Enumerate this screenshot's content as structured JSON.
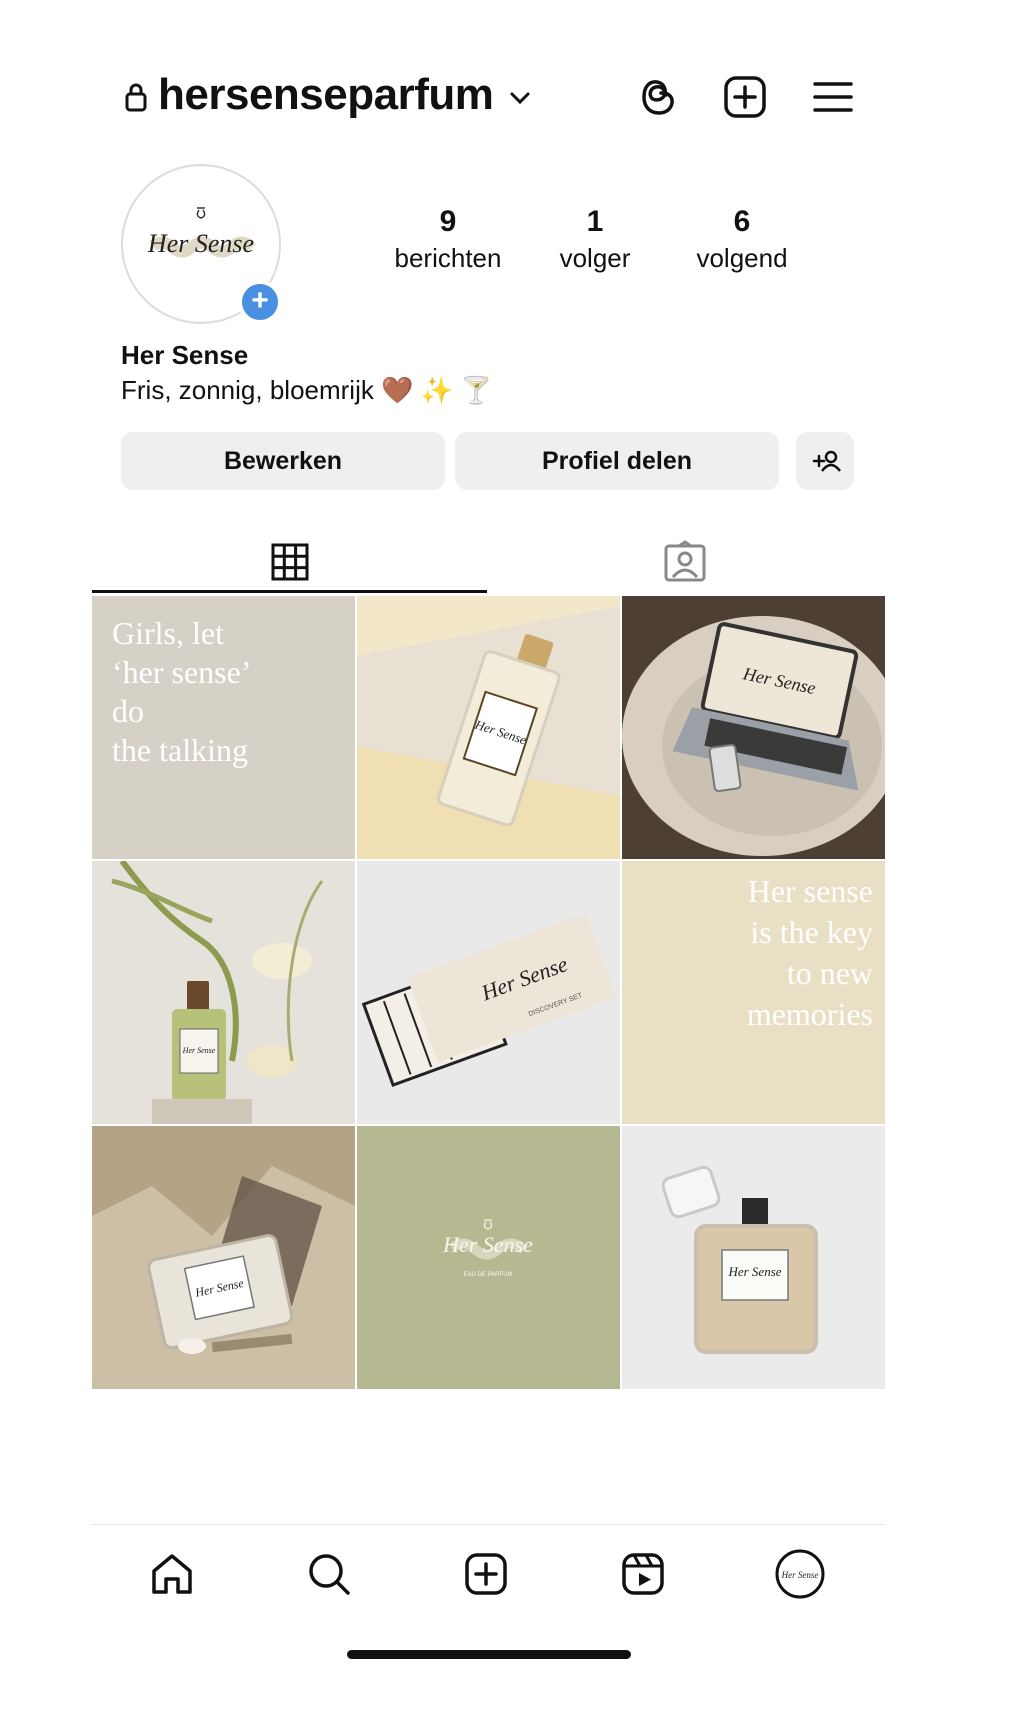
{
  "header": {
    "username": "hersenseparfum",
    "icons": [
      "lock-icon",
      "chevron-down-icon",
      "threads-icon",
      "create-icon",
      "menu-icon"
    ]
  },
  "avatar": {
    "logo_text": "Her Sense"
  },
  "stats": [
    {
      "value": "9",
      "label": "berichten"
    },
    {
      "value": "1",
      "label": "volger"
    },
    {
      "value": "6",
      "label": "volgend"
    }
  ],
  "profile": {
    "name": "Her Sense",
    "bio": "Fris, zonnig, bloemrijk 🤎 ✨ 🍸"
  },
  "buttons": {
    "edit": "Bewerken",
    "share": "Profiel delen"
  },
  "tabs": [
    "grid-tab",
    "tagged-tab"
  ],
  "posts": {
    "quote1": [
      "Girls, let",
      "‘her sense’",
      "do",
      "the talking"
    ],
    "quote2": [
      "Her sense",
      "is the key",
      "to new",
      "memories"
    ],
    "label_text": "Her Sense",
    "card_text": "Her Sense",
    "brand_text": "Her Sense",
    "card_subtext": "DISCOVERY SET",
    "brand_subtext": "EAU DE PARFUM"
  },
  "nav": [
    "home-icon",
    "search-icon",
    "create-icon",
    "reels-icon",
    "profile-avatar"
  ],
  "colors": {
    "accent_blue": "#4a90e2",
    "button_bg": "#efefef",
    "quote1_bg": "#d5d1c6",
    "quote2_bg": "#e9dfc5",
    "sage_bg": "#b5b891"
  }
}
